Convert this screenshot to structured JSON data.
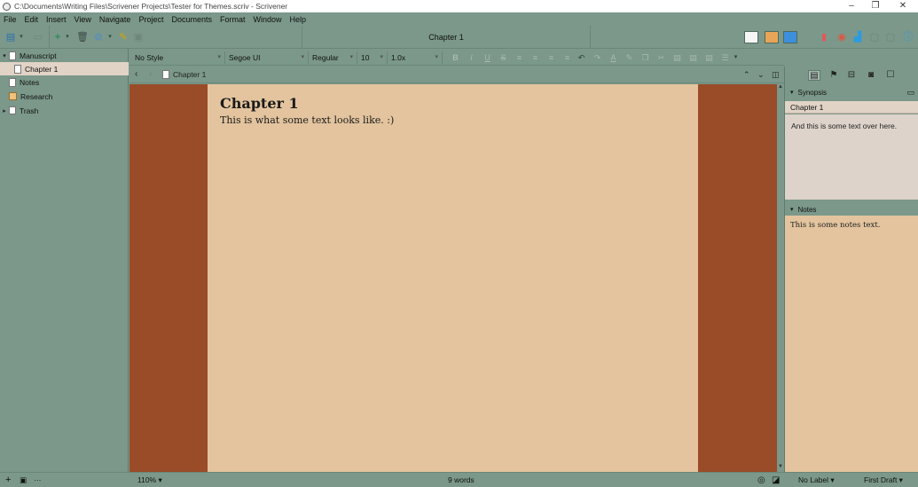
{
  "window": {
    "title": "C:\\Documents\\Writing Files\\Scrivener Projects\\Tester for Themes.scriv - Scrivener",
    "minimize": "–",
    "restore": "❐",
    "close": "✕"
  },
  "menu": [
    "File",
    "Edit",
    "Insert",
    "View",
    "Navigate",
    "Project",
    "Documents",
    "Format",
    "Window",
    "Help"
  ],
  "toolbar": {
    "document_title": "Chapter 1",
    "icons": [
      "binder-toggle-icon",
      "add-icon",
      "folder-icon",
      "trash-icon",
      "link-icon",
      "highlight-icon",
      "view-icons",
      "bookmark-icon",
      "target-icon",
      "stats-icon",
      "inspector-icon"
    ],
    "accent_colors": {
      "add": "#2e8b57",
      "bookmark": "#e05a5a",
      "stats": "#2b9be0",
      "info": "#2b9be0"
    }
  },
  "binder": {
    "items": [
      {
        "label": "Manuscript",
        "type": "doc",
        "expanded": true,
        "selected": false,
        "indent": 0
      },
      {
        "label": "Chapter 1",
        "type": "doc",
        "expanded": false,
        "selected": true,
        "indent": 1
      },
      {
        "label": "Notes",
        "type": "doc",
        "expanded": false,
        "selected": false,
        "indent": 0
      },
      {
        "label": "Research",
        "type": "folder",
        "expanded": false,
        "selected": false,
        "indent": 0
      },
      {
        "label": "Trash",
        "type": "trash",
        "expanded": false,
        "selected": false,
        "indent": 0
      }
    ],
    "footer": {
      "add": "+",
      "new_folder": "▣",
      "more": "···"
    }
  },
  "format_bar": {
    "style": "No Style",
    "font": "Segoe UI",
    "weight": "Regular",
    "size": "10",
    "line_spacing": "1.0x",
    "bold": "B",
    "italic": "I",
    "underline": "U",
    "strike": "S",
    "text_color": "A"
  },
  "path_bar": {
    "back": "‹",
    "forward": "›",
    "document": "Chapter 1",
    "up": "⌃",
    "down": "⌄",
    "split": "◫"
  },
  "editor": {
    "heading": "Chapter 1",
    "body": "This is what some text looks like. :)",
    "page_color": "#e3c49e",
    "margin_color": "#9a4b28"
  },
  "inspector": {
    "synopsis_header": "Synopsis",
    "synopsis_title": "Chapter 1",
    "synopsis_text": "And this is some text over here.",
    "notes_header": "Notes",
    "notes_text": "This is some notes text."
  },
  "status": {
    "zoom": "110%",
    "word_count": "9 words",
    "label": "No Label",
    "status_value": "First Draft"
  },
  "theme": {
    "chrome": "#7b988a",
    "selection": "#e1d3c6"
  }
}
